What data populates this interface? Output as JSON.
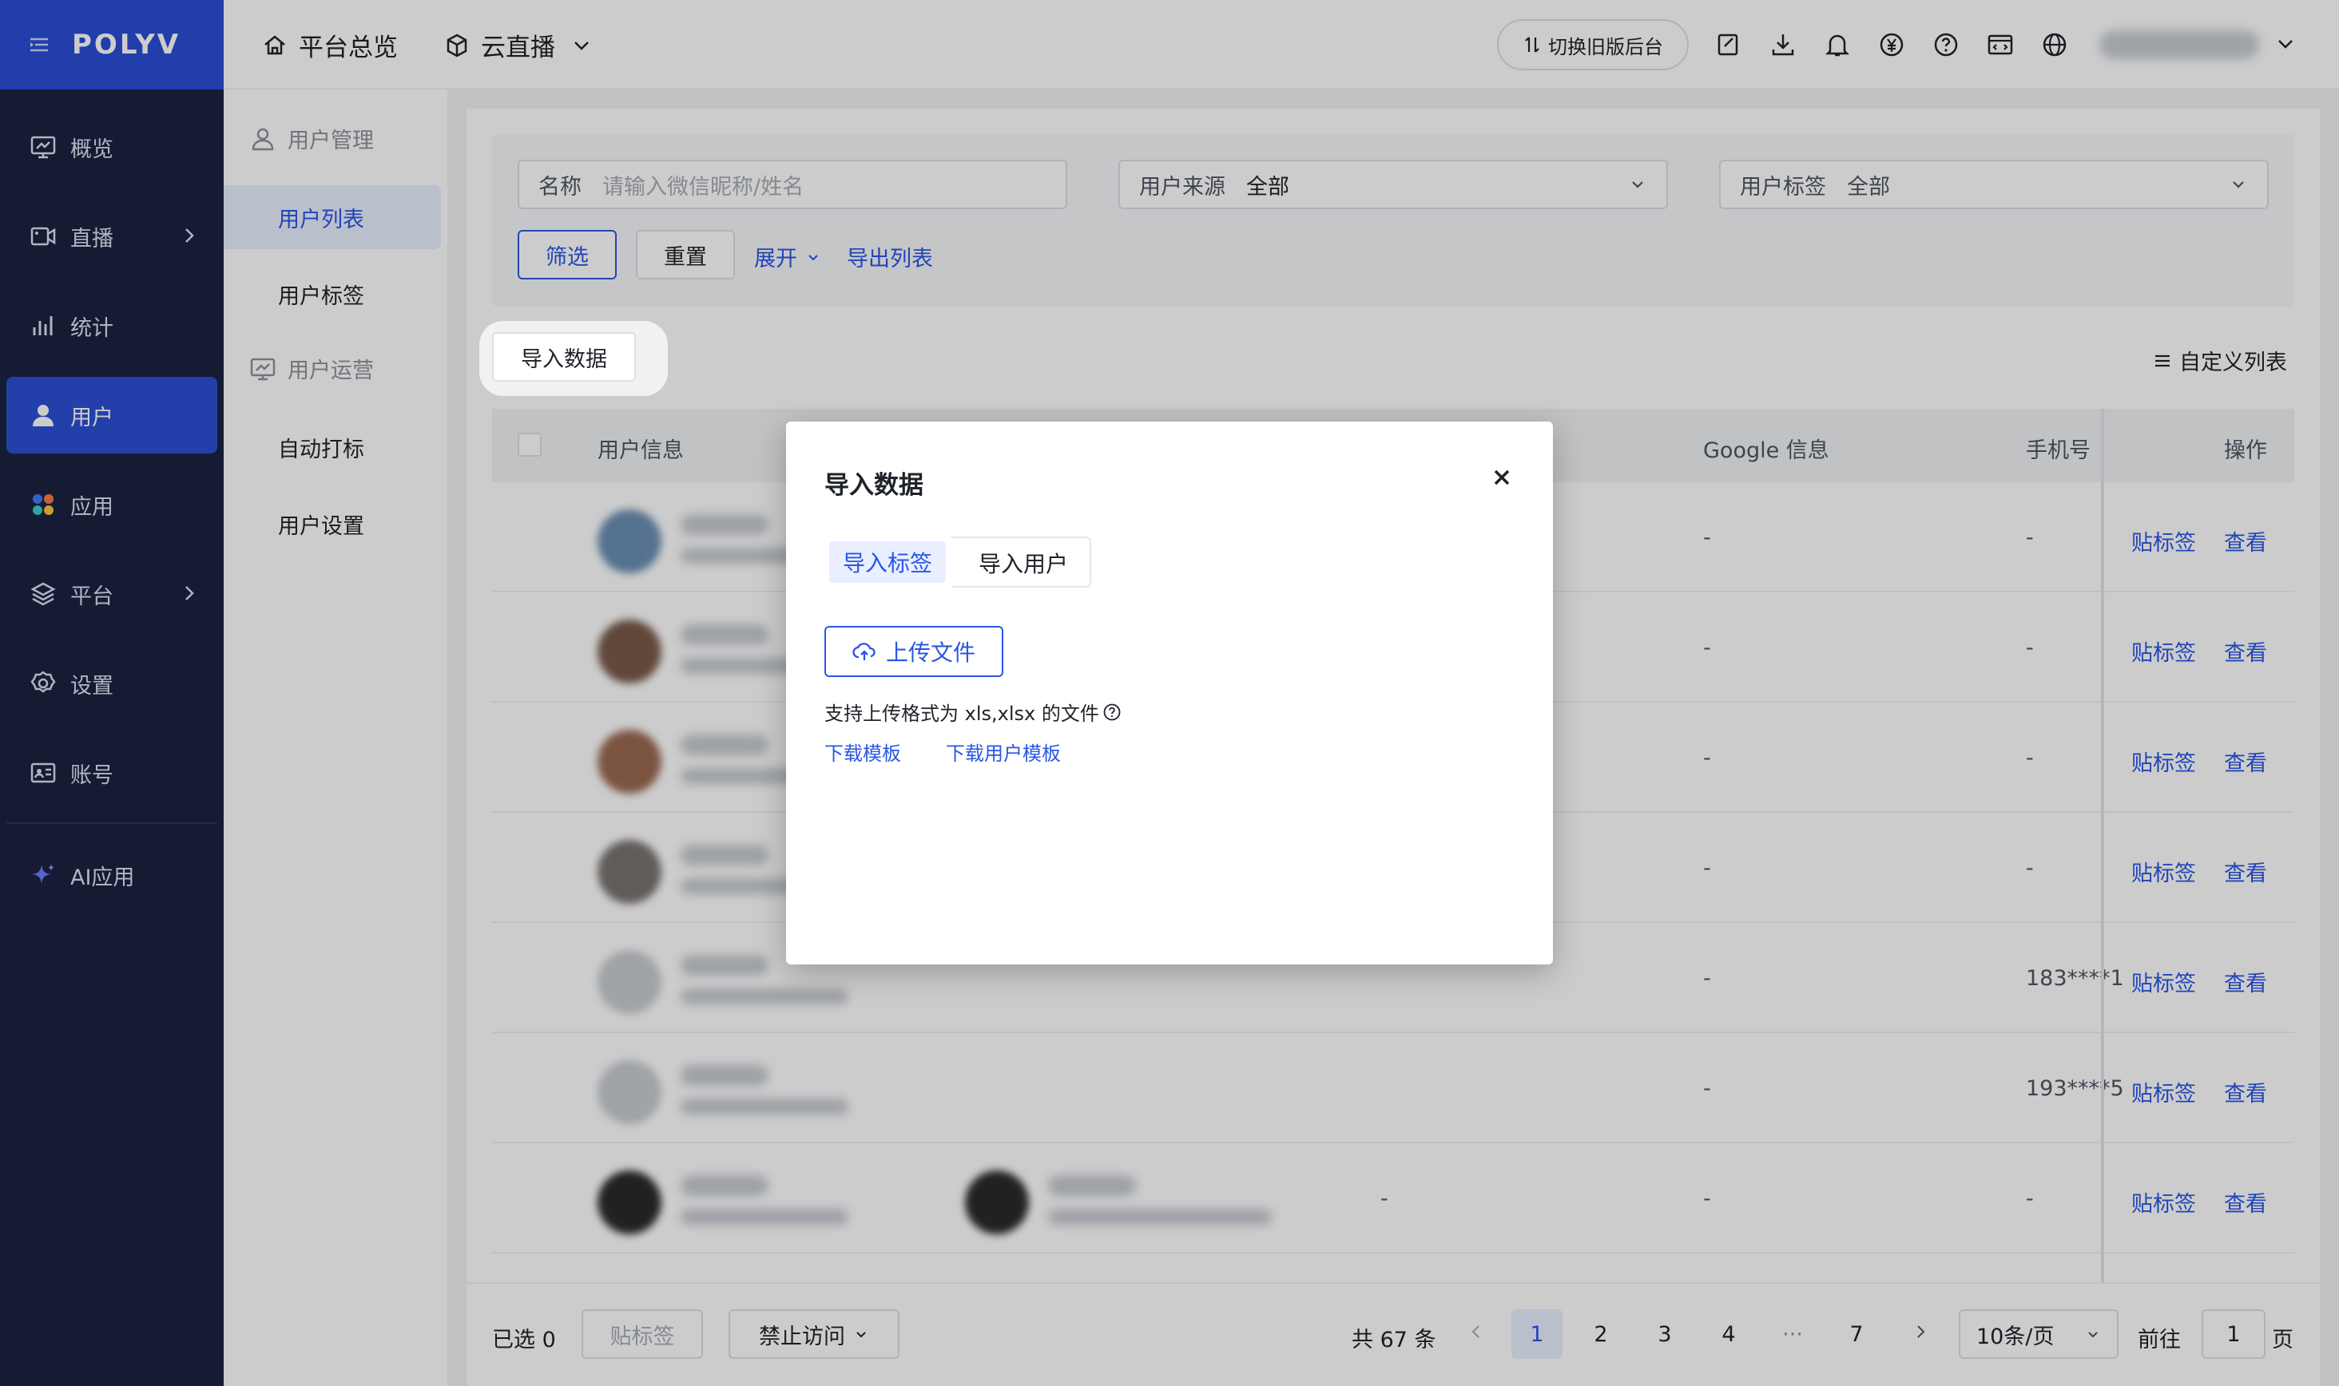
{
  "app": {
    "logo": "POLYV"
  },
  "sidebar": {
    "items": [
      {
        "label": "概览",
        "icon": "monitor-icon"
      },
      {
        "label": "直播",
        "icon": "video-icon"
      },
      {
        "label": "统计",
        "icon": "bar-chart-icon"
      },
      {
        "label": "用户",
        "icon": "user-icon"
      },
      {
        "label": "应用",
        "icon": "apps-icon"
      },
      {
        "label": "平台",
        "icon": "layers-icon"
      },
      {
        "label": "设置",
        "icon": "gear-icon"
      },
      {
        "label": "账号",
        "icon": "id-card-icon"
      },
      {
        "label": "AI应用",
        "icon": "sparkle-icon"
      }
    ]
  },
  "header": {
    "home_label": "平台总览",
    "product_label": "云直播",
    "switch_label": "切换旧版后台"
  },
  "subnav": {
    "group1": "用户管理",
    "items1": [
      "用户列表",
      "用户标签"
    ],
    "group2": "用户运营",
    "items2": [
      "自动打标",
      "用户设置"
    ]
  },
  "filters": {
    "name_label": "名称",
    "name_placeholder": "请输入微信昵称/姓名",
    "source_label": "用户来源",
    "source_value": "全部",
    "tag_label": "用户标签",
    "tag_value": "全部",
    "filter_btn": "筛选",
    "reset_btn": "重置",
    "expand_label": "展开",
    "export_label": "导出列表"
  },
  "toolbar": {
    "import_btn": "导入数据",
    "custom_columns": "自定义列表"
  },
  "table": {
    "headers": {
      "user_info": "用户信息",
      "google": "Google 信息",
      "phone": "手机号",
      "actions": "操作"
    },
    "rows": [
      {
        "mid": "",
        "google": "-",
        "phone": "-",
        "tag": "贴标签",
        "view": "查看"
      },
      {
        "mid": "",
        "google": "-",
        "phone": "-",
        "tag": "贴标签",
        "view": "查看"
      },
      {
        "mid": "",
        "google": "-",
        "phone": "-",
        "tag": "贴标签",
        "view": "查看"
      },
      {
        "mid": "",
        "google": "-",
        "phone": "-",
        "tag": "贴标签",
        "view": "查看"
      },
      {
        "mid": "",
        "google": "-",
        "phone": "183****1",
        "tag": "贴标签",
        "view": "查看"
      },
      {
        "mid": "",
        "google": "-",
        "phone": "193****5",
        "tag": "贴标签",
        "view": "查看"
      },
      {
        "mid": "-",
        "google": "-",
        "phone": "-",
        "tag": "贴标签",
        "view": "查看"
      }
    ]
  },
  "footer": {
    "selected": "已选 0",
    "tag_btn": "贴标签",
    "ban_btn": "禁止访问",
    "total": "共 67 条",
    "pages": [
      "1",
      "2",
      "3",
      "4",
      "···",
      "7"
    ],
    "page_size": "10条/页",
    "goto_label": "前往",
    "goto_value": "1",
    "page_suffix": "页"
  },
  "modal": {
    "title": "导入数据",
    "tab_tags": "导入标签",
    "tab_users": "导入用户",
    "upload_btn": "上传文件",
    "hint": "支持上传格式为 xls,xlsx 的文件",
    "download_template": "下载模板",
    "download_user_template": "下载用户模板"
  }
}
